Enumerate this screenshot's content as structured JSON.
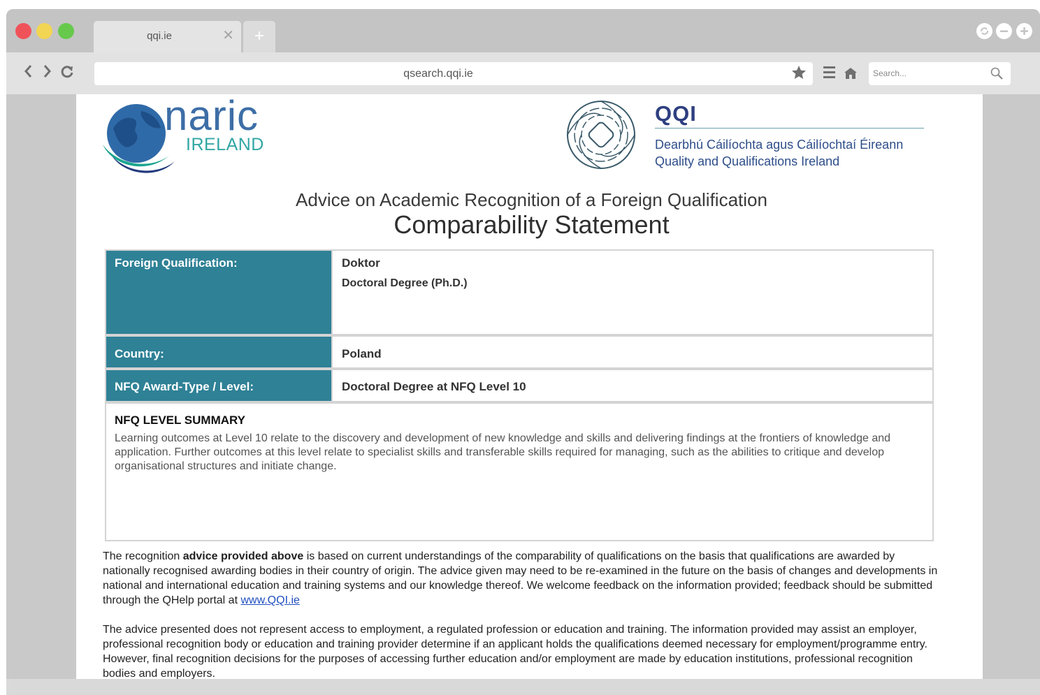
{
  "browser": {
    "tab_title": "qqi.ie",
    "tab_close": "✕",
    "new_tab": "+",
    "url": "qsearch.qqi.ie",
    "search_placeholder": "Search..."
  },
  "logos": {
    "naric_word": "naric",
    "naric_sub": "IRELAND",
    "qqi_word": "QQI",
    "qqi_irish": "Dearbhú Cáilíochta agus Cáilíochtaí Éireann",
    "qqi_english": "Quality and Qualifications Ireland"
  },
  "document": {
    "heading": "Advice on Academic Recognition of a Foreign Qualification",
    "title": "Comparability Statement",
    "rows": [
      {
        "label": "Foreign Qualification:",
        "value": "Doktor",
        "value2": "Doctoral Degree (Ph.D.)"
      },
      {
        "label": "Country:",
        "value": "Poland"
      },
      {
        "label": "NFQ Award-Type / Level:",
        "value": "Doctoral Degree at NFQ Level 10"
      }
    ],
    "summary_title": "NFQ LEVEL SUMMARY",
    "summary_text": "Learning outcomes at Level 10 relate to the discovery and development of new knowledge and skills and delivering findings at the frontiers of knowledge and application. Further outcomes at this level relate to specialist skills and transferable skills required for managing, such as the abilities to critique and develop organisational structures and initiate change.",
    "para1_a": "The recognition ",
    "para1_bold": "advice provided above",
    "para1_b": " is based on current understandings of the comparability of qualifications on the basis that qualifications are awarded by nationally recognised awarding bodies in their country of origin. The advice given may need to be re-examined in the future on the basis of changes and developments in national and international education and training systems and our knowledge thereof. We welcome feedback on the information provided; feedback should be submitted through the QHelp portal at ",
    "para1_link": "www.QQI.ie",
    "para2": "The advice presented does not represent access to employment, a regulated profession or education and training. The information provided may assist an employer, professional recognition body or education and training provider determine if an applicant holds the qualifications deemed necessary for employment/programme entry. However, final recognition decisions for the purposes of accessing further education and/or employment are made by education institutions, professional recognition bodies and employers."
  }
}
